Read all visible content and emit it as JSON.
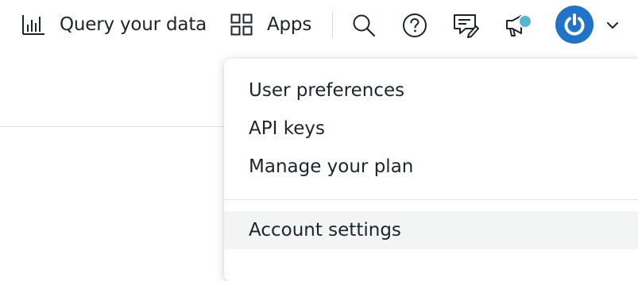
{
  "topbar": {
    "query_label": "Query your data",
    "apps_label": "Apps",
    "icons": {
      "query": "bar-chart-icon",
      "apps": "grid-icon",
      "search": "search-icon",
      "help": "help-icon",
      "feedback": "feedback-icon",
      "announcements": "megaphone-icon",
      "avatar": "power-icon",
      "menu": "chevron-down-icon"
    }
  },
  "colors": {
    "text": "#1d252c",
    "avatar_blue": "#1f73c9",
    "notification_dot": "#54b7cf",
    "menu_hover": "#f3f4f4"
  },
  "user_menu": {
    "items": [
      {
        "label": "User preferences"
      },
      {
        "label": "API keys"
      },
      {
        "label": "Manage your plan"
      }
    ],
    "account_settings": "Account settings"
  }
}
